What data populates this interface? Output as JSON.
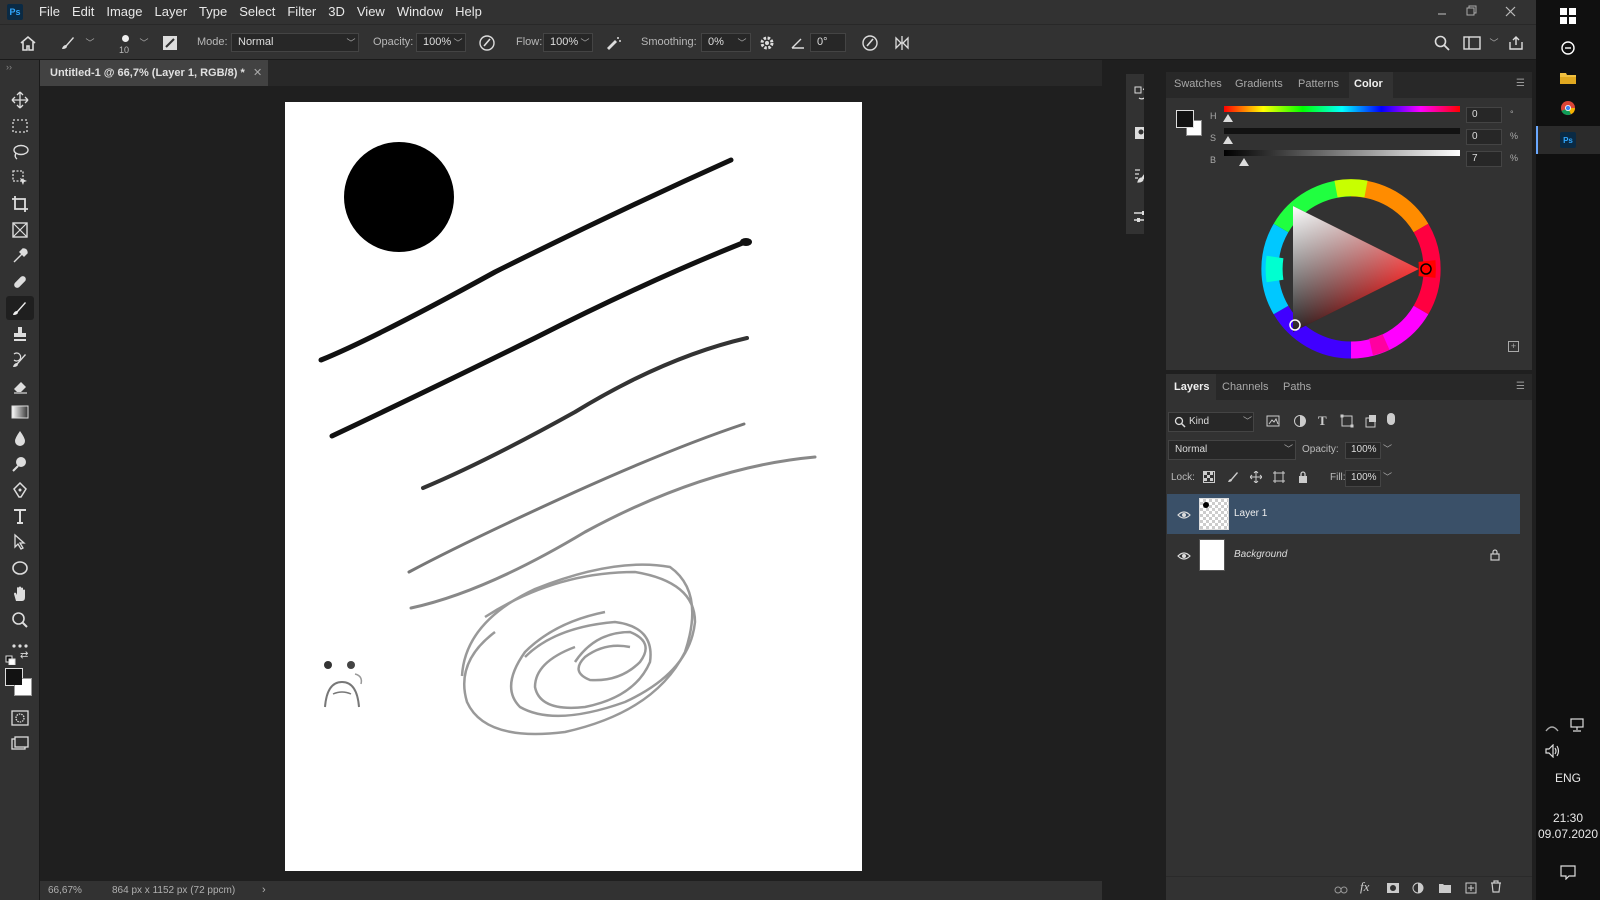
{
  "app": {
    "logo": "Ps",
    "menu": [
      "File",
      "Edit",
      "Image",
      "Layer",
      "Type",
      "Select",
      "Filter",
      "3D",
      "View",
      "Window",
      "Help"
    ]
  },
  "options_bar": {
    "brush_size": "10",
    "mode_label": "Mode:",
    "mode_value": "Normal",
    "opacity_label": "Opacity:",
    "opacity_value": "100%",
    "flow_label": "Flow:",
    "flow_value": "100%",
    "smoothing_label": "Smoothing:",
    "smoothing_value": "0%",
    "angle_value": "0°"
  },
  "document": {
    "tab_title": "Untitled-1 @ 66,7% (Layer 1, RGB/8) *",
    "zoom": "66,67%",
    "doc_info": "864 px x 1152 px (72 ppcm)"
  },
  "color_panel": {
    "tabs": [
      "Swatches",
      "Gradients",
      "Patterns",
      "Color"
    ],
    "active_tab": "Color",
    "h_label": "H",
    "h_value": "0",
    "h_unit": "°",
    "s_label": "S",
    "s_value": "0",
    "s_unit": "%",
    "b_label": "B",
    "b_value": "7",
    "b_unit": "%",
    "foreground_color": "#121212",
    "background_color": "#ffffff"
  },
  "layers_panel": {
    "tabs": [
      "Layers",
      "Channels",
      "Paths"
    ],
    "active_tab": "Layers",
    "filter_kind": "Kind",
    "blend_mode": "Normal",
    "opacity_label": "Opacity:",
    "opacity_value": "100%",
    "lock_label": "Lock:",
    "fill_label": "Fill:",
    "fill_value": "100%",
    "layers": [
      {
        "name": "Layer 1",
        "selected": true,
        "locked": false
      },
      {
        "name": "Background",
        "selected": false,
        "locked": true
      }
    ]
  },
  "taskbar": {
    "language": "ENG",
    "time": "21:30",
    "date": "09.07.2020"
  },
  "colors": {
    "selected_layer": "#3a5068",
    "accent": "#31a8ff"
  }
}
